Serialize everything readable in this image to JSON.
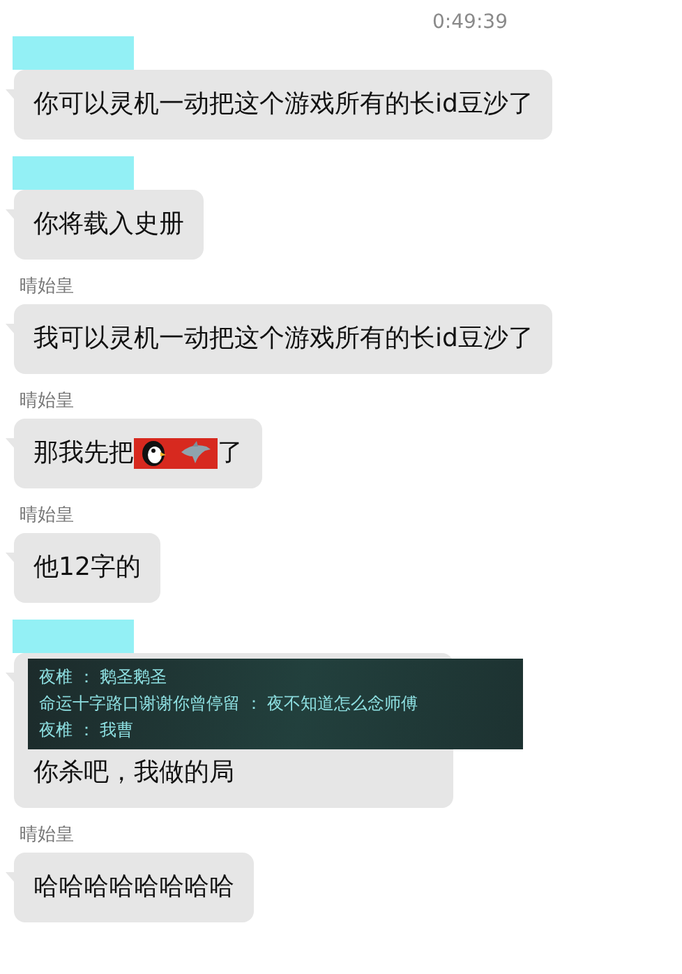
{
  "timestamp": "0:49:39",
  "messages": [
    {
      "sender": {
        "kind": "redacted"
      },
      "parts": [
        {
          "kind": "text",
          "text": "你可以灵机一动把这个游戏所有的长id豆沙了"
        }
      ]
    },
    {
      "sender": {
        "kind": "redacted"
      },
      "parts": [
        {
          "kind": "text",
          "text": "你将载入史册"
        }
      ]
    },
    {
      "sender": {
        "kind": "name",
        "name": "晴始皇"
      },
      "parts": [
        {
          "kind": "text",
          "text": "我可以灵机一动把这个游戏所有的长id豆沙了"
        }
      ]
    },
    {
      "sender": {
        "kind": "name",
        "name": "晴始皇"
      },
      "parts": [
        {
          "kind": "text",
          "text": "那我先把"
        },
        {
          "kind": "sticker"
        },
        {
          "kind": "text",
          "text": "了"
        }
      ]
    },
    {
      "sender": {
        "kind": "name",
        "name": "晴始皇"
      },
      "parts": [
        {
          "kind": "text",
          "text": "他12字的"
        }
      ]
    },
    {
      "sender": {
        "kind": "redacted"
      },
      "parts": [
        {
          "kind": "screenshot",
          "lines": [
            {
              "speaker": "夜椎",
              "separator": "：",
              "text": "鹅圣鹅圣"
            },
            {
              "speaker": "命运十字路口谢谢你曾停留",
              "separator": "：",
              "text": "夜不知道怎么念师傅"
            },
            {
              "speaker": "夜椎",
              "separator": "：",
              "text": "我曹"
            }
          ]
        },
        {
          "kind": "text",
          "text": "你杀吧，我做的局"
        }
      ]
    },
    {
      "sender": {
        "kind": "name",
        "name": "晴始皇"
      },
      "parts": [
        {
          "kind": "text",
          "text": "哈哈哈哈哈哈哈哈"
        }
      ]
    }
  ]
}
